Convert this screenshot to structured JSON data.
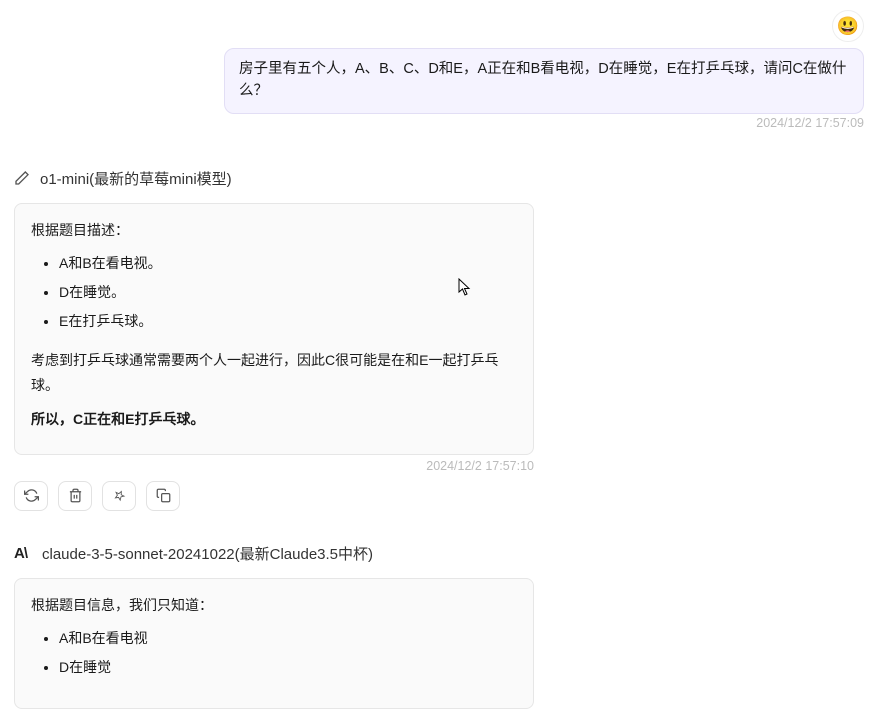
{
  "user": {
    "avatar_emoji": "😃",
    "message": "房子里有五个人，A、B、C、D和E，A正在和B看电视，D在睡觉，E在打乒乓球，请问C在做什么？",
    "timestamp": "2024/12/2 17:57:09"
  },
  "responses": [
    {
      "model_name": "o1-mini(最新的草莓mini模型)",
      "icon": "pencil",
      "intro": "根据题目描述：",
      "bullets": [
        "A和B在看电视。",
        "D在睡觉。",
        "E在打乒乓球。"
      ],
      "reasoning": "考虑到打乒乓球通常需要两个人一起进行，因此C很可能是在和E一起打乒乓球。",
      "conclusion": "所以，C正在和E打乒乓球。",
      "timestamp": "2024/12/2 17:57:10"
    },
    {
      "model_name": "claude-3-5-sonnet-20241022(最新Claude3.5中杯)",
      "icon": "anthropic",
      "intro": "根据题目信息，我们只知道：",
      "bullets": [
        "A和B在看电视",
        "D在睡觉"
      ]
    }
  ],
  "actions": {
    "regenerate": "regenerate",
    "delete": "delete",
    "pin": "pin",
    "copy": "copy"
  }
}
